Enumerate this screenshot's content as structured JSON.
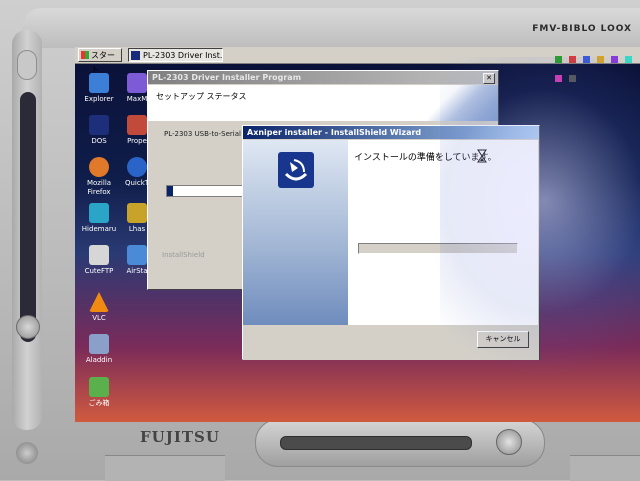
{
  "device": {
    "brand_top": "FMV-BIBLO LOOX",
    "brand_bottom": "FUJITSU"
  },
  "taskbar": {
    "start_label": "スタート",
    "task_button_label": "PL-2303 Driver Inst..."
  },
  "desktop_icons": [
    {
      "label": "Explorer",
      "color": "#3c7fd6"
    },
    {
      "label": "MaxM",
      "color": "#7d5ad6"
    },
    {
      "label": "DOS",
      "color": "#1d2f7a"
    },
    {
      "label": "Prope",
      "color": "#c24a3a"
    },
    {
      "label": "Mozilla Firefox",
      "color": "#e07a2a"
    },
    {
      "label": "QuickT",
      "color": "#2a64c8"
    },
    {
      "label": "Hidemaru",
      "color": "#2aa5c8"
    },
    {
      "label": "Lhas",
      "color": "#c8a32a"
    },
    {
      "label": "CuteFTP",
      "color": "#d6d6d6"
    },
    {
      "label": "AirSta",
      "color": "#4a8ad6"
    },
    {
      "label": "VLC",
      "color": "#f08a10"
    },
    {
      "label": "Aladdin",
      "color": "#8aa0c8"
    },
    {
      "label": "ごみ箱",
      "color": "#5ab04a"
    }
  ],
  "installer_window": {
    "title": "PL-2303 Driver Installer Program",
    "header_title": "セットアップ ステータス",
    "description": "PL-2303 USB-to-Serial が新しいソフトウェアのインストールを構成中です。",
    "progress": 0.05,
    "brand": "InstallShield"
  },
  "wizard_window": {
    "title": "Axniper installer - InstallShield Wizard",
    "status": "インストールの準備をしています。",
    "progress": 0.0,
    "cancel_label": "キャンセル",
    "accent": "#0a246a"
  }
}
